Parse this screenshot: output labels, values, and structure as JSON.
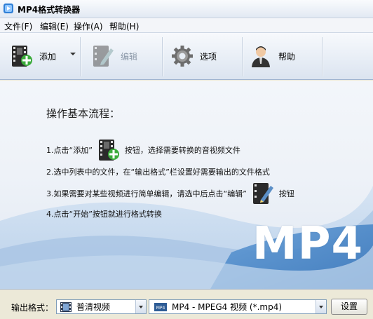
{
  "window": {
    "title": "MP4格式转换器"
  },
  "menu": {
    "items": [
      {
        "label": "文件(F)"
      },
      {
        "label": "编辑(E)"
      },
      {
        "label": "操作(A)"
      },
      {
        "label": "帮助(H)"
      }
    ]
  },
  "toolbar": {
    "add_label": "添加",
    "edit_label": "编辑",
    "options_label": "选项",
    "help_label": "帮助"
  },
  "main": {
    "heading": "操作基本流程：",
    "step1_before": "1.点击“添加”",
    "step1_after": "按钮，选择需要转换的音视频文件",
    "step2": "2.选中列表中的文件，在“输出格式”栏设置好需要输出的文件格式",
    "step3_before": "3.如果需要对某些视频进行简单编辑，请选中后点击“编辑”",
    "step3_after": "按钮",
    "step4": "4.点击“开始”按钮就进行格式转换",
    "logo_text": "MP4"
  },
  "bottom": {
    "output_label": "输出格式：",
    "category_value": "普清视频",
    "format_value": "MP4 - MPEG4 视频 (*.mp4)",
    "settings_label": "设置"
  },
  "colors": {
    "toolbar_bg": "#e8eef6",
    "wave_blue": "#4f8ac9",
    "disabled_text": "#8d9aaa"
  }
}
